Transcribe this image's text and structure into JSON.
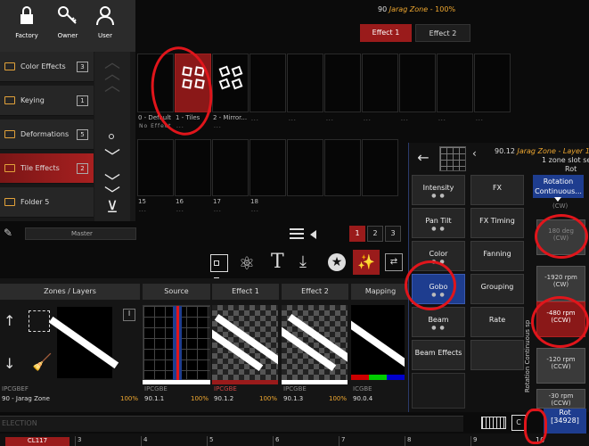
{
  "toolbar": {
    "factory": "Factory",
    "owner": "Owner",
    "user": "User"
  },
  "header": {
    "zone_num": "90",
    "zone_name": "Jarag Zone",
    "zone_pct": "100%",
    "effect1": "Effect 1",
    "effect2": "Effect 2"
  },
  "folders": [
    {
      "label": "Color Effects",
      "count": "3"
    },
    {
      "label": "Keying",
      "count": "1"
    },
    {
      "label": "Deformations",
      "count": "5"
    },
    {
      "label": "Tile Effects",
      "count": "2"
    },
    {
      "label": "Folder 5",
      "count": ""
    }
  ],
  "master": "Master",
  "effects_grid": {
    "row1": [
      {
        "label": "0 - Default",
        "sub": "No Effect"
      },
      {
        "label": "1 - Tiles",
        "sub": "..."
      },
      {
        "label": "2 - Mirror...",
        "sub": "..."
      },
      {
        "label": "",
        "sub": "..."
      },
      {
        "label": "",
        "sub": "..."
      },
      {
        "label": "",
        "sub": "..."
      },
      {
        "label": "",
        "sub": "..."
      },
      {
        "label": "",
        "sub": "..."
      },
      {
        "label": "",
        "sub": "..."
      },
      {
        "label": "",
        "sub": "..."
      }
    ],
    "row2": [
      {
        "label": "15",
        "sub": "..."
      },
      {
        "label": "16",
        "sub": "..."
      },
      {
        "label": "17",
        "sub": "..."
      },
      {
        "label": "18",
        "sub": "..."
      }
    ]
  },
  "pages": [
    "1",
    "2",
    "3"
  ],
  "layers": {
    "headers": [
      "Zones / Layers",
      "Source",
      "Effect 1",
      "Effect 2",
      "Mapping"
    ],
    "zone": {
      "code": "IPCGBEF",
      "name": "90 - Jarag Zone",
      "pct": "100%"
    },
    "source": {
      "code": "IPCGBE",
      "id": "90.1.1",
      "pct": "100%"
    },
    "effect1": {
      "code": "IPCGBE",
      "id": "90.1.2",
      "pct": "100%"
    },
    "effect2": {
      "code": "IPCGBE",
      "id": "90.1.3",
      "pct": "100%"
    },
    "mapping": {
      "code": "ICGBE",
      "id": "90.0.4"
    }
  },
  "panel": {
    "zone_num": "90.12",
    "zone_name": "Jarag Zone - Layer 1 -",
    "selected": "1 zone slot sele",
    "rot": "Rot",
    "left": [
      {
        "label": "Intensity",
        "dots": "● ●"
      },
      {
        "label": "Pan Tilt",
        "dots": "● ●"
      },
      {
        "label": "Color",
        "dots": "● ●"
      },
      {
        "label": "Gobo",
        "dots": "● ●"
      },
      {
        "label": "Beam",
        "dots": "● ●"
      },
      {
        "label": "Beam Effects",
        "dots": ""
      }
    ],
    "mid": [
      {
        "label": "FX"
      },
      {
        "label": "FX Timing"
      },
      {
        "label": "Fanning"
      },
      {
        "label": "Grouping"
      },
      {
        "label": "Rate"
      },
      {
        "label": ""
      }
    ],
    "rotation_header": "Rotation Continuous...",
    "rot_values": [
      {
        "v": "180 deg",
        "d": "(CW)"
      },
      {
        "v": "-1920 rpm",
        "d": "(CW)"
      },
      {
        "v": "-480 rpm",
        "d": "(CCW)"
      },
      {
        "v": "-120 rpm",
        "d": "(CCW)"
      },
      {
        "v": "-30 rpm",
        "d": "(CCW)"
      }
    ],
    "top_partial": "(CW)",
    "vertical": "Rotation Continuous sp",
    "bottom_rot": "Rot",
    "bottom_val": "[34928]"
  },
  "status": {
    "selection": "ELECTION",
    "cue": "CL117",
    "page": "10",
    "slots": [
      "3",
      "4",
      "5",
      "6",
      "7",
      "8",
      "9"
    ]
  },
  "colors": {
    "accent": "#9a1b1b",
    "orange": "#f0a830",
    "blue": "#1e3d8f"
  }
}
